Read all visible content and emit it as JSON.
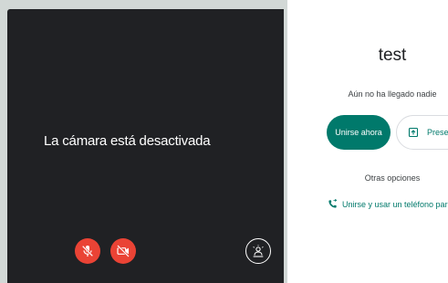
{
  "preview": {
    "camera_off_text": "La cámara está desactivada",
    "mic_icon": "mic-off-icon",
    "camera_icon": "camera-off-icon",
    "effects_icon": "visual-effects-icon"
  },
  "join": {
    "meeting_title": "test",
    "status_text": "Aún no ha llegado nadie",
    "join_button_label": "Unirse ahora",
    "present_button_label": "Presentar",
    "present_icon": "present-screen-icon",
    "other_options_label": "Otras opciones",
    "phone_option_label": "Unirse y usar un teléfono para el au",
    "phone_icon": "phone-forwarded-icon"
  },
  "colors": {
    "accent": "#00796b",
    "danger": "#ea4335",
    "preview_bg": "#202124"
  }
}
